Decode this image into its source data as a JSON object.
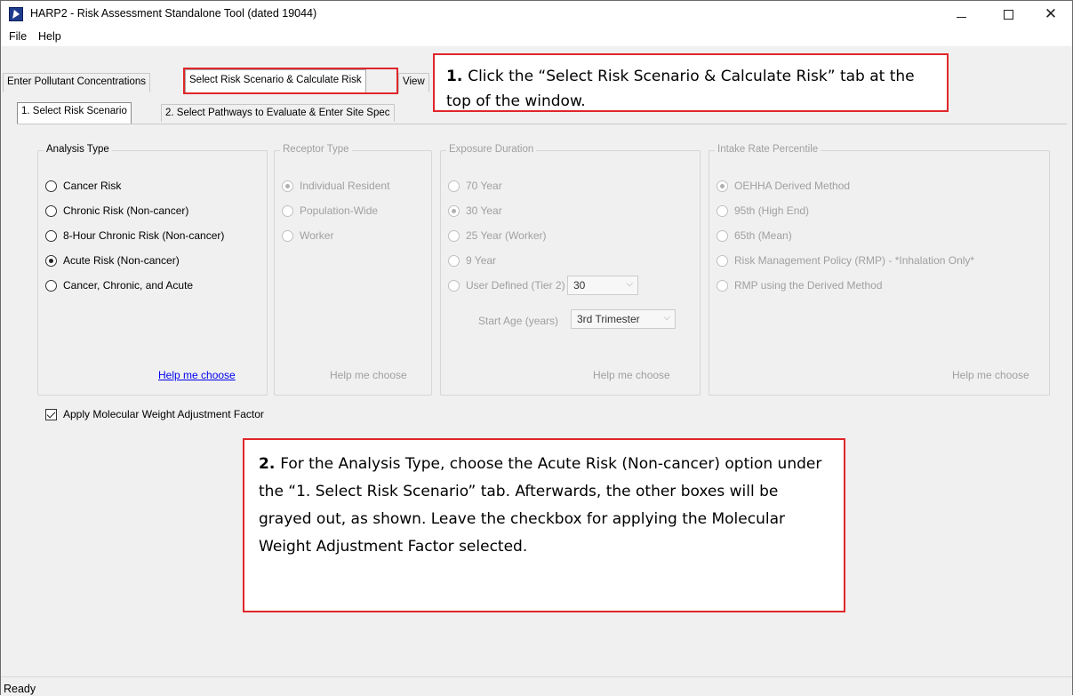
{
  "window": {
    "title": "HARP2 - Risk Assessment Standalone Tool (dated 19044)",
    "minimize_icon": "minimize-icon",
    "maximize_icon": "maximize-icon",
    "close_icon": "close-icon"
  },
  "menu": {
    "items": [
      {
        "label": "File"
      },
      {
        "label": "Help"
      }
    ]
  },
  "outer_tabs": [
    {
      "label": "Enter Pollutant Concentrations",
      "active": false
    },
    {
      "label": "Select Risk Scenario & Calculate Risk",
      "active": true
    },
    {
      "label": "View",
      "active": false
    }
  ],
  "inner_tabs": [
    {
      "label": "1. Select Risk Scenario",
      "active": true
    },
    {
      "label": "2. Select Pathways to Evaluate & Enter Site Spec",
      "active": false
    }
  ],
  "analysis_type": {
    "legend": "Analysis Type",
    "options": [
      {
        "label": "Cancer Risk",
        "checked": false
      },
      {
        "label": "Chronic Risk (Non-cancer)",
        "checked": false
      },
      {
        "label": "8-Hour Chronic Risk (Non-cancer)",
        "checked": false
      },
      {
        "label": "Acute Risk (Non-cancer)",
        "checked": true
      },
      {
        "label": "Cancer, Chronic, and Acute",
        "checked": false
      }
    ],
    "help": "Help me choose"
  },
  "receptor_type": {
    "legend": "Receptor Type",
    "enabled": false,
    "options": [
      {
        "label": "Individual Resident",
        "checked": true
      },
      {
        "label": "Population-Wide",
        "checked": false
      },
      {
        "label": "Worker",
        "checked": false
      }
    ],
    "help": "Help me choose"
  },
  "exposure_duration": {
    "legend": "Exposure Duration",
    "enabled": false,
    "options": [
      {
        "label": "70 Year",
        "checked": false
      },
      {
        "label": "30 Year",
        "checked": true
      },
      {
        "label": "25 Year (Worker)",
        "checked": false
      },
      {
        "label": "9 Year",
        "checked": false
      },
      {
        "label": "User Defined (Tier 2)",
        "checked": false
      }
    ],
    "user_defined_value": "30",
    "start_age_label": "Start Age (years)",
    "start_age_value": "3rd Trimester",
    "help": "Help me choose"
  },
  "intake_rate": {
    "legend": "Intake Rate Percentile",
    "enabled": false,
    "options": [
      {
        "label": "OEHHA Derived Method",
        "checked": true
      },
      {
        "label": "95th (High End)",
        "checked": false
      },
      {
        "label": "65th (Mean)",
        "checked": false
      },
      {
        "label": "Risk Management Policy (RMP) - *Inhalation Only*",
        "checked": false
      },
      {
        "label": "RMP using the Derived Method",
        "checked": false
      }
    ],
    "help": "Help me choose"
  },
  "mwaf_checkbox": {
    "label": "Apply Molecular Weight Adjustment Factor",
    "checked": true
  },
  "callouts": {
    "step1_num": "1.",
    "step1_text": "Click the “Select Risk Scenario & Calculate Risk” tab at the top of the window.",
    "step2_num": "2.",
    "step2_text": "For the Analysis Type, choose the Acute Risk (Non-cancer) option under the “1. Select Risk Scenario” tab.  Afterwards, the other boxes will be grayed out, as shown.  Leave the checkbox for applying the Molecular Weight Adjustment Factor selected."
  },
  "status": {
    "text": "Ready"
  },
  "colors": {
    "callout_border": "#e0262a",
    "link": "#0000ee",
    "disabled_text": "#a0a0a0"
  }
}
